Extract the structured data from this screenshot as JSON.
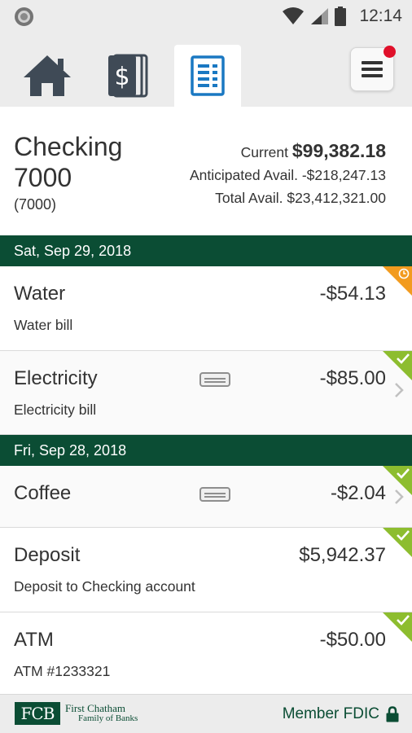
{
  "status_bar": {
    "time": "12:14"
  },
  "nav": {
    "tabs": [
      {
        "name": "home",
        "icon": "home-icon"
      },
      {
        "name": "accounts",
        "icon": "dollar-cards-icon"
      },
      {
        "name": "transactions",
        "icon": "document-list-icon",
        "active": true
      }
    ],
    "menu_icon": "hamburger-menu-icon",
    "notification_color": "#e0102a"
  },
  "account": {
    "name": "Checking 7000",
    "number": "(7000)",
    "current_label": "Current",
    "current_value": "$99,382.18",
    "anticipated_label": "Anticipated Avail.",
    "anticipated_value": "-$218,247.13",
    "total_label": "Total Avail.",
    "total_value": "$23,412,321.00"
  },
  "groups": [
    {
      "date": "Sat, Sep 29, 2018",
      "transactions": [
        {
          "name": "Water",
          "amount": "-$54.13",
          "description": "Water bill",
          "status": "pending"
        },
        {
          "name": "Electricity",
          "amount": "-$85.00",
          "description": "Electricity bill",
          "status": "cleared",
          "has_receipt": true
        }
      ]
    },
    {
      "date": "Fri, Sep 28, 2018",
      "transactions": [
        {
          "name": "Coffee",
          "amount": "-$2.04",
          "description": "",
          "status": "cleared",
          "has_receipt": true
        },
        {
          "name": "Deposit",
          "amount": "$5,942.37",
          "description": "Deposit to Checking account",
          "status": "cleared"
        },
        {
          "name": "ATM",
          "amount": "-$50.00",
          "description": "ATM #1233321",
          "status": "cleared"
        }
      ]
    }
  ],
  "footer": {
    "logo_mark": "FCB",
    "logo_line1": "First Chatham",
    "logo_line2": "Family of Banks",
    "fdic": "Member FDIC"
  },
  "colors": {
    "brand_green": "#0b4d34",
    "pending_orange": "#f29b1f",
    "cleared_green": "#8dbd2f",
    "active_tab_blue": "#1a78c2"
  }
}
